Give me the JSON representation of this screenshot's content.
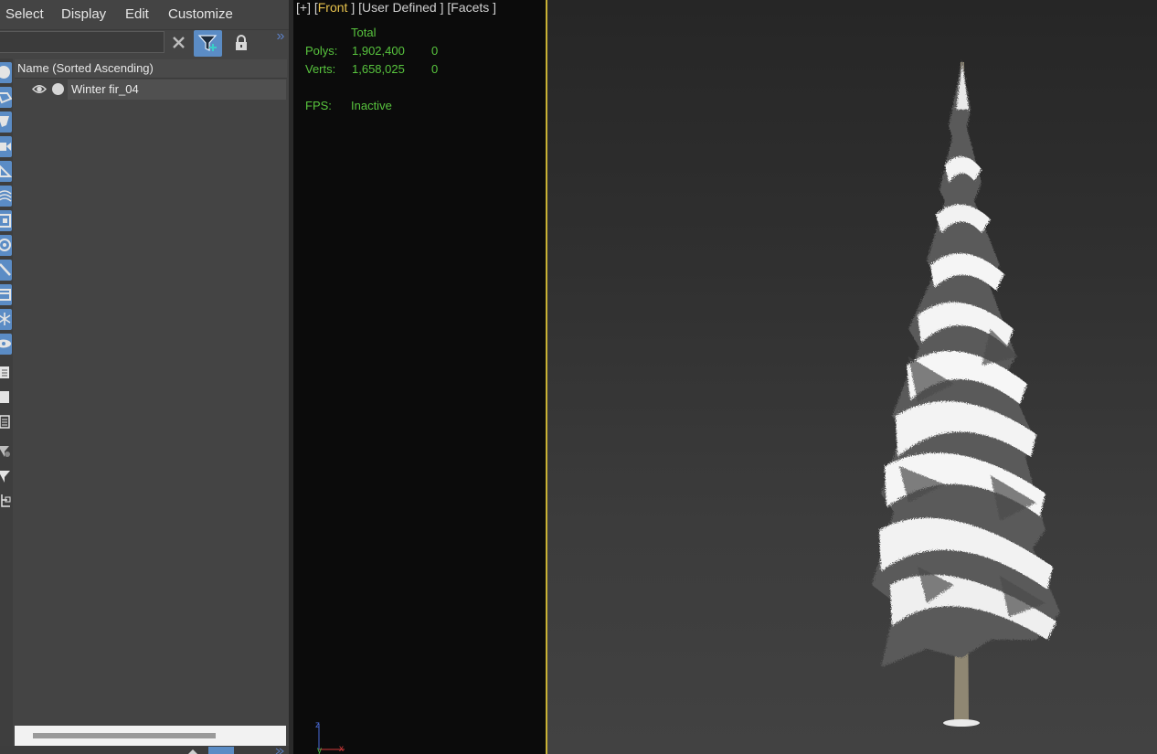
{
  "menu": {
    "items": [
      "Select",
      "Display",
      "Edit",
      "Customize"
    ]
  },
  "scene_explorer": {
    "search_value": "",
    "search_placeholder": "",
    "column_header": "Name (Sorted Ascending)",
    "rows": [
      {
        "name": "Winter fir_04"
      }
    ],
    "expand_glyph": "»",
    "filter_active": true
  },
  "viewport_front": {
    "label_plus": "[+]",
    "label_view": "Front",
    "label_shading": "User Defined",
    "label_mode": "Facets",
    "stats": {
      "total_header": "Total",
      "polys_label": "Polys:",
      "polys_total": "1,902,400",
      "polys_selected": "0",
      "verts_label": "Verts:",
      "verts_total": "1,658,025",
      "verts_selected": "0",
      "fps_label": "FPS:",
      "fps_value": "Inactive"
    },
    "axis_labels": {
      "z": "z",
      "x": "x",
      "y": "y"
    }
  },
  "icons": {
    "clear": "close-icon",
    "filter": "filter-icon",
    "lock": "lock-icon",
    "eye": "eye-icon"
  },
  "colors": {
    "accent": "#5b8cc5",
    "stats_text": "#58c43e",
    "active_view": "#e7c24d",
    "viewport_border": "#c9b235"
  }
}
